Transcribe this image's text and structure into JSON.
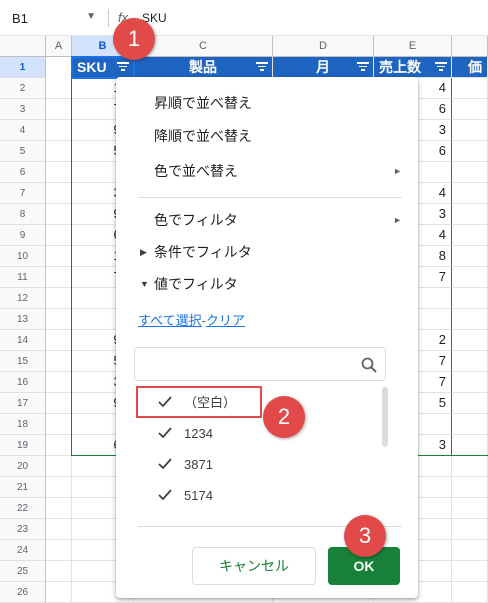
{
  "formula_bar": {
    "cell_ref": "B1",
    "fx": "fx",
    "value": "SKU"
  },
  "columns": [
    "A",
    "B",
    "C",
    "D",
    "E",
    ""
  ],
  "rows": [
    "1",
    "2",
    "3",
    "4",
    "5",
    "6",
    "7",
    "8",
    "9",
    "10",
    "11",
    "12",
    "13",
    "14",
    "15",
    "16",
    "17",
    "18",
    "19",
    "20",
    "21",
    "22",
    "23",
    "24",
    "25",
    "26"
  ],
  "headers": {
    "sku": "SKU",
    "product": "製品",
    "month": "月",
    "qty": "売上数",
    "price": "価"
  },
  "sku_col": [
    "12",
    "76",
    "97",
    "51",
    "",
    "38",
    "93",
    "63",
    "12",
    "76",
    "",
    "",
    "97",
    "51",
    "38",
    "93",
    "",
    "63"
  ],
  "qty_col": [
    "4",
    "6",
    "3",
    "6",
    "",
    "4",
    "3",
    "4",
    "8",
    "7",
    "",
    "",
    "2",
    "7",
    "7",
    "5",
    "",
    "3"
  ],
  "menu": {
    "sort_asc": "昇順で並べ替え",
    "sort_desc": "降順で並べ替え",
    "sort_color": "色で並べ替え",
    "filter_color": "色でフィルタ",
    "filter_condition": "条件でフィルタ",
    "filter_values": "値でフィルタ",
    "select_all": "すべて選択",
    "separator": "-",
    "clear": "クリア",
    "search_placeholder": "",
    "values": [
      "（空白）",
      "1234",
      "3871",
      "5174"
    ],
    "cancel": "キャンセル",
    "ok": "OK"
  },
  "badges": {
    "b1": "1",
    "b2": "2",
    "b3": "3"
  },
  "icons": {
    "submenu": "chevron-right-icon",
    "check": "check-icon",
    "search": "search-icon",
    "filter": "filter-icon"
  },
  "colors": {
    "header_blue": "#1f64c1",
    "ok_green": "#188038",
    "badge_red": "#e24a4a",
    "select_blue": "#1a73e8"
  }
}
